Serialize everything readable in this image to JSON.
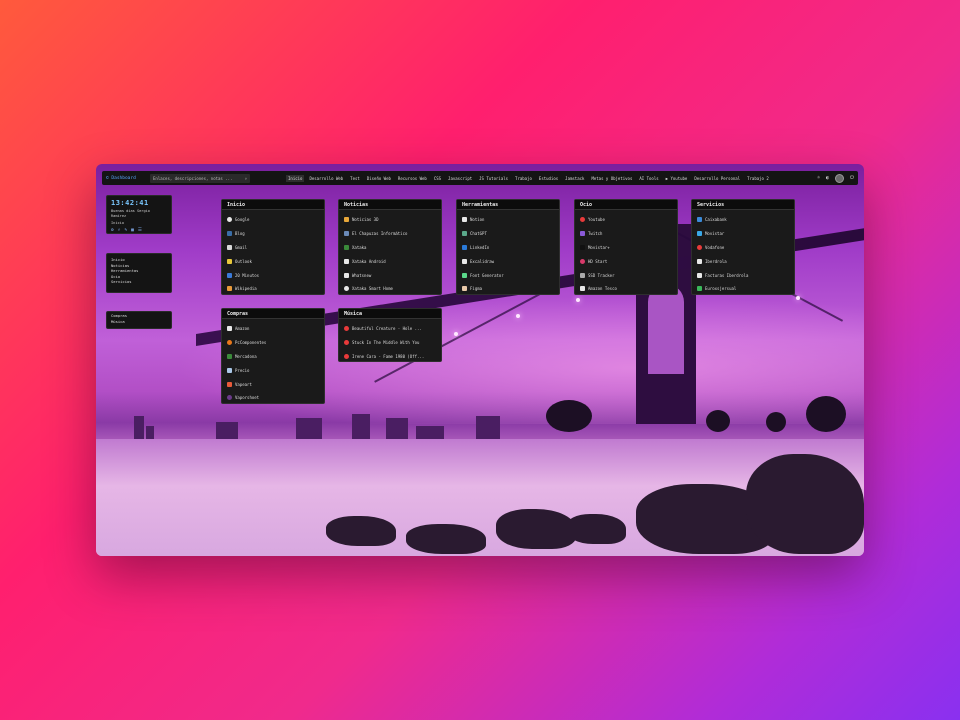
{
  "topbar": {
    "brand": "© Dashboard",
    "search_placeholder": "Enlaces, descripciones, notas ...",
    "search_icon": "search-icon",
    "nav": [
      "Inicio",
      "Desarrollo Web",
      "Test",
      "Diseño Web",
      "Recursos Web",
      "CSS",
      "Javascript",
      "JS Tutorials",
      "Trabajo",
      "Estudios",
      "Jamstack",
      "Metas y Objetivos",
      "AI Tools",
      "▶ Youtube",
      "Desarrollo Personal",
      "Trabajo 2"
    ],
    "active_nav": "Inicio"
  },
  "clock": {
    "time": "13:42:41",
    "greeting": "Buenas días Sergio Ramírez",
    "sub": "Inicio"
  },
  "left_menu": [
    "Inicio",
    "Noticias",
    "Herramientas",
    "Ocio",
    "Servicios"
  ],
  "left_menu2": [
    "Compras",
    "Música"
  ],
  "cards": {
    "inicio": {
      "title": "Inicio",
      "items": [
        "Google",
        "Blog",
        "Gmail",
        "Outlook",
        "20 Minutos",
        "Wikipedia"
      ]
    },
    "noticias": {
      "title": "Noticias",
      "items": [
        "Noticias 3D",
        "El Chapuzas Informático",
        "Xataka",
        "Xataka Android",
        "Whatsnew",
        "Xataka Smart Home"
      ]
    },
    "herramientas": {
      "title": "Herramientas",
      "items": [
        "Notion",
        "ChatGPT",
        "LinkedIn",
        "Excalidraw",
        "Font Generator",
        "Figma"
      ]
    },
    "ocio": {
      "title": "Ocio",
      "items": [
        "Youtube",
        "Twitch",
        "Movistar+",
        "HD Start",
        "SSD Tracker",
        "Amazon Tesco"
      ]
    },
    "servicios": {
      "title": "Servicios",
      "items": [
        "Caixabank",
        "Movistar",
        "Vodafone",
        "Iberdrola",
        "Facturas Iberdrola",
        "Euroxsjersual"
      ]
    },
    "compras": {
      "title": "Compras",
      "items": [
        "Amazon",
        "PcComponentes",
        "Mercadona",
        "Precio",
        "Vapeart",
        "Vaporshoet"
      ]
    },
    "musica": {
      "title": "Música",
      "items": [
        "Beautiful Creature - Hole ...",
        "Stuck In The Middle With You",
        "Irene Cara - Fame 1980 (Off..."
      ]
    }
  },
  "colors": {
    "accent": "#5aa8ff",
    "card_bg": "#1a1a1a"
  }
}
